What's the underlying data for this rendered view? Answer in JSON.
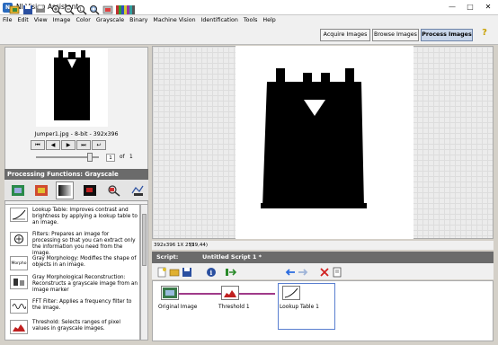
{
  "app": {
    "title": "NI Vision Assistant"
  },
  "menu": [
    "File",
    "Edit",
    "View",
    "Image",
    "Color",
    "Grayscale",
    "Binary",
    "Machine Vision",
    "Identification",
    "Tools",
    "Help"
  ],
  "tabs": {
    "acquire": "Acquire Images",
    "browse": "Browse Images",
    "process": "Process Images"
  },
  "help_glyph": "?",
  "image_info": {
    "caption": "Jumper1.jpg - 8-bit - 392x396",
    "page_current": "1",
    "page_of": "of",
    "page_total": "1"
  },
  "processing": {
    "title": "Processing Functions: Grayscale"
  },
  "functions": [
    {
      "icon": "lookup-table-icon",
      "text": "Lookup Table: Improves contrast and brightness by applying a lookup table to an image."
    },
    {
      "icon": "filters-icon",
      "text": "Filters: Prepares an image for processing so that you can extract only the information you need from the image."
    },
    {
      "icon": "gray-morphology-icon",
      "icon_text": "Morpho",
      "text": "Gray Morphology: Modifies the shape of objects in an image."
    },
    {
      "icon": "gray-reconstruction-icon",
      "text": "Gray Morphological Reconstruction: Reconstructs a grayscale image from an image marker"
    },
    {
      "icon": "fft-filter-icon",
      "text": "FFT Filter: Applies a frequency filter to the image."
    },
    {
      "icon": "threshold-icon",
      "text": "Threshold: Selects ranges of pixel values in grayscale images."
    }
  ],
  "status": {
    "size": "392x396 1X 255",
    "coords": "(29,44)"
  },
  "script": {
    "label": "Script:",
    "name": "Untitled Script 1 *"
  },
  "steps": [
    {
      "label": "Original Image",
      "icon": "original-image-icon"
    },
    {
      "label": "Threshold 1",
      "icon": "threshold-icon"
    },
    {
      "label": "Lookup Table 1",
      "icon": "lookup-table-icon"
    }
  ],
  "colors": {
    "panel_header": "#6b6b6b",
    "active_tab": "#c9d6ea",
    "connector": "#a03a8a",
    "selection": "#5a7fd0"
  }
}
